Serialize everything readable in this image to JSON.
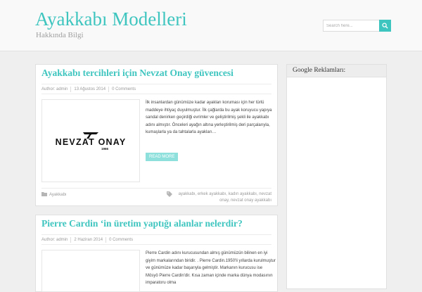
{
  "header": {
    "site_title": "Ayakkabı Modelleri",
    "tagline": "Hakkında Bilgi",
    "search": {
      "placeholder": "Search here...",
      "icon": "search-icon"
    }
  },
  "colors": {
    "accent": "#3fc5bf",
    "read_more_bg": "#8ee0dc",
    "background": "#efefef"
  },
  "posts": [
    {
      "title": "Ayakkabı tercihleri için Nevzat Onay güvencesi",
      "meta": {
        "author": "Author: admin",
        "date": "13 Ağustos 2014",
        "comments": "0 Comments"
      },
      "thumbnail": {
        "logo_text": "NEVZAT ONAY",
        "logo_year": "1966"
      },
      "excerpt": "İlk insanlardan günümüze kadar ayakları koruması için her türlü maddeye ihtiyaç duyulmuştur. İlk çağlarda bu ayak koruyucu yapıya sandal denirken geçirdiği evrimler ve geliştirilmiş şekli ile ayakkabı adını almıştır. Önceleri ayağın altına yerleştirilmiş deri parçalarıyla, kumaşlarla ya da tahtalarla ayakları…",
      "read_more": "READ MORE",
      "category": "Ayakkabı",
      "tags": "ayakkabı, erkek ayakkabı, kadın ayakkabı, nevzat onay, nevzat onay ayakkabı"
    },
    {
      "title": "Pierre Cardin ‘in üretim yaptığı alanlar nelerdir?",
      "meta": {
        "author": "Author: admin",
        "date": "2 Haziran 2014",
        "comments": "0 Comments"
      },
      "excerpt": "Pierre Cardin adını kurucusundan almış günümüzün bilinen en iyi giyim markalarından biridir. . Pierre Cardin.1950'li yıllarda kurulmuştur ve günümüze kadar başarıyla gelmiştir. Markanın kurucusu ise Mösyö Pierre Cardin'dir. Kısa zaman içinde marka dünya modasının imparatoru olma"
    }
  ],
  "sidebar": {
    "widget_title": "Google Reklamları:"
  }
}
